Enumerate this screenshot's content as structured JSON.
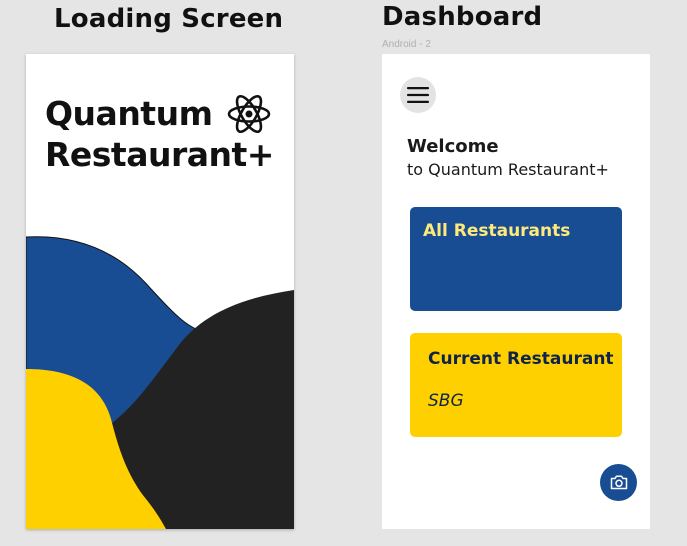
{
  "frames": {
    "loading": {
      "title": "Loading Screen"
    },
    "dashboard": {
      "title": "Dashboard",
      "subtitle": "Android - 2"
    }
  },
  "loading_screen": {
    "brand_line_1": "Quantum",
    "brand_line_2": "Restaurant+",
    "brand_icon": "atom-icon"
  },
  "dashboard": {
    "menu_icon": "hamburger-menu-icon",
    "welcome_title": "Welcome",
    "welcome_subtitle": "to Quantum Restaurant+",
    "cards": {
      "all_restaurants": {
        "label": "All Restaurants"
      },
      "current_restaurant": {
        "label": "Current Restaurant",
        "value": "SBG"
      }
    },
    "camera_icon": "camera-icon"
  },
  "colors": {
    "canvas": "#e5e5e5",
    "primary_blue": "#184d94",
    "accent_yellow": "#ffd000",
    "dark": "#222222",
    "card_title_on_blue": "#ffe97a",
    "text_on_yellow": "#10244a"
  }
}
